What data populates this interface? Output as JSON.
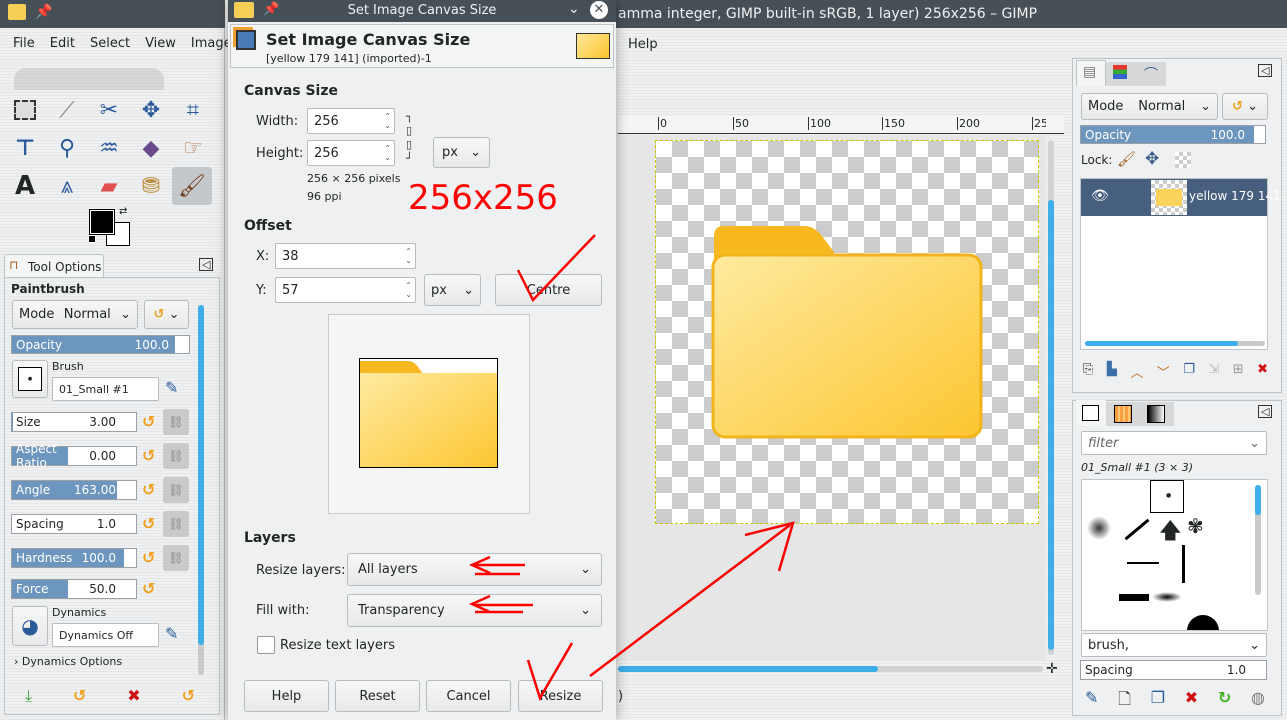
{
  "gimp_main": {
    "title": "amma integer, GIMP built-in sRGB, 1 layer) 256x256 – GIMP",
    "menu_help": "Help",
    "status_fragment": ")",
    "ruler_ticks": [
      "0",
      "50",
      "100",
      "150",
      "200",
      "25"
    ]
  },
  "toolbox": {
    "menu": [
      "File",
      "Edit",
      "Select",
      "View",
      "Image"
    ]
  },
  "tool_options": {
    "tab": "Tool Options",
    "tool": "Paintbrush",
    "mode_label": "Mode",
    "mode_value": "Normal",
    "opacity_label": "Opacity",
    "opacity_value": "100.0",
    "brush_label": "Brush",
    "brush_value": "01_Small #1",
    "sliders": [
      {
        "label": "Size",
        "value": "3.00",
        "fill": 0.01
      },
      {
        "label": "Aspect Ratio",
        "value": "0.00",
        "fill": 0.45
      },
      {
        "label": "Angle",
        "value": "163.00",
        "fill": 0.85
      },
      {
        "label": "Spacing",
        "value": "1.0",
        "fill": 0.0
      },
      {
        "label": "Hardness",
        "value": "100.0",
        "fill": 0.9
      },
      {
        "label": "Force",
        "value": "50.0",
        "fill": 0.45
      }
    ],
    "dynamics_label": "Dynamics",
    "dynamics_value": "Dynamics Off",
    "dynamics_options": "Dynamics Options"
  },
  "dialog": {
    "window_title": "Set Image Canvas Size",
    "heading": "Set Image Canvas Size",
    "subtitle": "[yellow 179 141] (imported)-1",
    "canvas_size": {
      "section": "Canvas Size",
      "width_label": "Width:",
      "width": "256",
      "height_label": "Height:",
      "height": "256",
      "unit": "px",
      "info_pixels": "256 × 256 pixels",
      "info_ppi": "96 ppi"
    },
    "offset": {
      "section": "Offset",
      "x_label": "X:",
      "x": "38",
      "y_label": "Y:",
      "y": "57",
      "unit": "px",
      "centre": "Centre"
    },
    "layers": {
      "section": "Layers",
      "resize_label": "Resize layers:",
      "resize_value": "All layers",
      "fill_label": "Fill with:",
      "fill_value": "Transparency",
      "resize_text": "Resize text layers",
      "resize_text_checked": false
    },
    "buttons": {
      "help": "Help",
      "reset": "Reset",
      "cancel": "Cancel",
      "resize": "Resize"
    }
  },
  "annotation": {
    "text": "256x256",
    "color": "#ff0000"
  },
  "layers_dock": {
    "mode_label": "Mode",
    "mode_value": "Normal",
    "opacity_label": "Opacity",
    "opacity_value": "100.0",
    "lock_label": "Lock:",
    "layer_name": "yellow 179 141."
  },
  "brushes_dock": {
    "filter_placeholder": "filter",
    "brush_title": "01_Small #1 (3 × 3)",
    "tag_value": "brush,",
    "spacing_label": "Spacing",
    "spacing_value": "1.0"
  }
}
